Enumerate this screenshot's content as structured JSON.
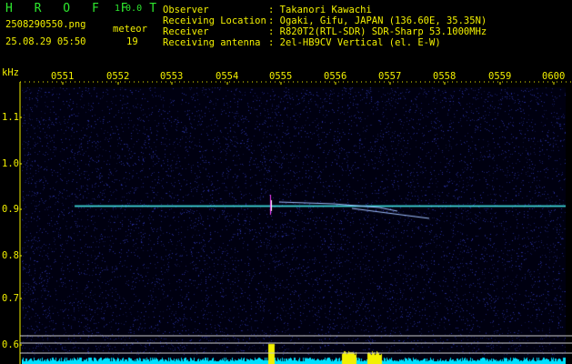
{
  "header": {
    "app_title": "H R O F F T",
    "version": "1.0.0",
    "filename": "2508290550.png",
    "datetime": "25.08.29 05:50",
    "count_label": "meteor",
    "count_value": "19"
  },
  "info": {
    "observer_label": "Observer",
    "observer_value": ": Takanori Kawachi",
    "location_label": "Receiving Location",
    "location_value": ": Ogaki, Gifu, JAPAN (136.60E, 35.35N)",
    "receiver_label": "Receiver",
    "receiver_value": ": R820T2(RTL-SDR) SDR-Sharp 53.1000MHz",
    "antenna_label": "Receiving antenna",
    "antenna_value": ": 2el-HB9CV Vertical (el. E-W)"
  },
  "axes": {
    "freq_unit": "kHz",
    "freq_ticks": [
      "1.1",
      "1.0",
      "0.9",
      "0.8",
      "0.7",
      "0.6"
    ],
    "time_ticks": [
      "0551",
      "0552",
      "0553",
      "0554",
      "0555",
      "0556",
      "0557",
      "0558",
      "0559",
      "0600"
    ]
  },
  "colors": {
    "background": "#000000",
    "noise": "#1a2a8a",
    "carrier": "#40e0e0",
    "meteor": "#ff40ff",
    "level": "#00e0ff",
    "level_peak": "#f2f000",
    "text_green": "#2ee82e",
    "text_yellow": "#f2f000"
  }
}
